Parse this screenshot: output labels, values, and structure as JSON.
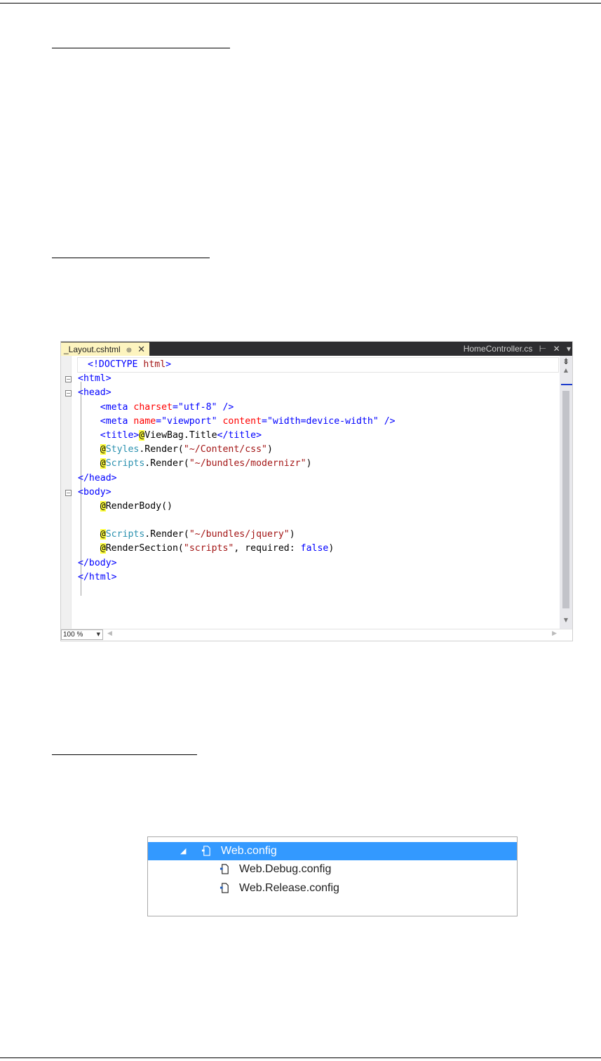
{
  "editor": {
    "active_tab": "_Layout.cshtml",
    "active_tab_pin": "⊕",
    "active_tab_close": "✕",
    "right_tab": "HomeController.cs",
    "right_tab_pin": "⊢",
    "right_tab_close": "✕",
    "right_tab_menu": "▾",
    "zoom": "100 %",
    "code_lines": [
      [
        {
          "t": "<!DOCTYPE ",
          "c": "t-blue"
        },
        {
          "t": "html",
          "c": "t-red"
        },
        {
          "t": ">",
          "c": "t-blue"
        }
      ],
      [
        {
          "t": "<html>",
          "c": "t-blue"
        }
      ],
      [
        {
          "t": "<head>",
          "c": "t-blue"
        }
      ],
      [
        {
          "t": "    <meta ",
          "c": "t-blue"
        },
        {
          "t": "charset",
          "c": "t-attr"
        },
        {
          "t": "=\"utf-8\" />",
          "c": "t-blue"
        }
      ],
      [
        {
          "t": "    <meta ",
          "c": "t-blue"
        },
        {
          "t": "name",
          "c": "t-attr"
        },
        {
          "t": "=\"viewport\" ",
          "c": "t-blue"
        },
        {
          "t": "content",
          "c": "t-attr"
        },
        {
          "t": "=\"width=device-width\" />",
          "c": "t-blue"
        }
      ],
      [
        {
          "t": "    <title>",
          "c": "t-blue"
        },
        {
          "t": "@",
          "c": "t-at"
        },
        {
          "t": "ViewBag.Title",
          "c": "t-black"
        },
        {
          "t": "</title>",
          "c": "t-blue"
        }
      ],
      [
        {
          "t": "    ",
          "c": "t-black"
        },
        {
          "t": "@",
          "c": "t-at"
        },
        {
          "t": "Styles",
          "c": "t-teal"
        },
        {
          "t": ".Render(",
          "c": "t-black"
        },
        {
          "t": "\"~/Content/css\"",
          "c": "t-red"
        },
        {
          "t": ")",
          "c": "t-black"
        }
      ],
      [
        {
          "t": "    ",
          "c": "t-black"
        },
        {
          "t": "@",
          "c": "t-at"
        },
        {
          "t": "Scripts",
          "c": "t-teal"
        },
        {
          "t": ".Render(",
          "c": "t-black"
        },
        {
          "t": "\"~/bundles/modernizr\"",
          "c": "t-red"
        },
        {
          "t": ")",
          "c": "t-black"
        }
      ],
      [
        {
          "t": "</head>",
          "c": "t-blue"
        }
      ],
      [
        {
          "t": "<body>",
          "c": "t-blue"
        }
      ],
      [
        {
          "t": "    ",
          "c": "t-black"
        },
        {
          "t": "@",
          "c": "t-at"
        },
        {
          "t": "RenderBody()",
          "c": "t-black"
        }
      ],
      [
        {
          "t": "",
          "c": "t-black"
        }
      ],
      [
        {
          "t": "    ",
          "c": "t-black"
        },
        {
          "t": "@",
          "c": "t-at"
        },
        {
          "t": "Scripts",
          "c": "t-teal"
        },
        {
          "t": ".Render(",
          "c": "t-black"
        },
        {
          "t": "\"~/bundles/jquery\"",
          "c": "t-red"
        },
        {
          "t": ")",
          "c": "t-black"
        }
      ],
      [
        {
          "t": "    ",
          "c": "t-black"
        },
        {
          "t": "@",
          "c": "t-at"
        },
        {
          "t": "RenderSection(",
          "c": "t-black"
        },
        {
          "t": "\"scripts\"",
          "c": "t-red"
        },
        {
          "t": ", required: ",
          "c": "t-black"
        },
        {
          "t": "false",
          "c": "t-blue"
        },
        {
          "t": ")",
          "c": "t-black"
        }
      ],
      [
        {
          "t": "</body>",
          "c": "t-blue"
        }
      ],
      [
        {
          "t": "</html>",
          "c": "t-blue"
        }
      ]
    ],
    "fold_markers": [
      "",
      "⊟",
      "⊟",
      "",
      "",
      "",
      "",
      "",
      "",
      "⊟",
      "",
      "",
      "",
      "",
      "",
      ""
    ]
  },
  "solution_explorer": {
    "items": [
      {
        "label": "Web.config",
        "expander": "◢",
        "selected": true
      },
      {
        "label": "Web.Debug.config",
        "expander": "",
        "selected": false
      },
      {
        "label": "Web.Release.config",
        "expander": "",
        "selected": false
      }
    ]
  },
  "colors": {
    "selection": "#3399ff",
    "tab_active": "#fdf4bf",
    "tabbar": "#2d2d30"
  }
}
